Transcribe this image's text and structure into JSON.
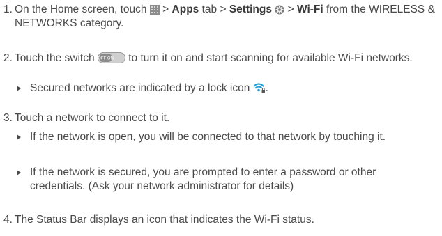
{
  "steps": [
    {
      "number": "1.",
      "parts": {
        "a": "On the Home screen, touch",
        "b": " > ",
        "c": "Apps",
        "d": " tab > ",
        "e": "Settings",
        "f": " > ",
        "g": "Wi-Fi",
        "h": " from the WIRELESS & NETWORKS category."
      }
    },
    {
      "number": "2.",
      "parts": {
        "a": "Touch the switch",
        "b": "to turn it on and start scanning for available Wi-Fi networks."
      },
      "bullets": [
        {
          "a": "Secured networks are indicated by a lock icon",
          "b": "."
        }
      ]
    },
    {
      "number": "3.",
      "text": "Touch a network to connect to it.",
      "bullets": [
        {
          "text": "If the network is open, you will be connected to that network by touching it."
        },
        {
          "text": "If the network is secured, you are prompted to enter a password or other credentials. (Ask your network administrator for details)"
        }
      ]
    },
    {
      "number": "4.",
      "text": "The Status Bar displays an icon that indicates the Wi-Fi status."
    }
  ],
  "icons": {
    "apps": "apps-grid-icon",
    "settings": "settings-gear-icon",
    "switch": "wifi-toggle-switch-icon",
    "switch_label": "OFF ON",
    "wifi_lock": "wifi-lock-icon",
    "wifi_color": "#2a9fd6"
  }
}
